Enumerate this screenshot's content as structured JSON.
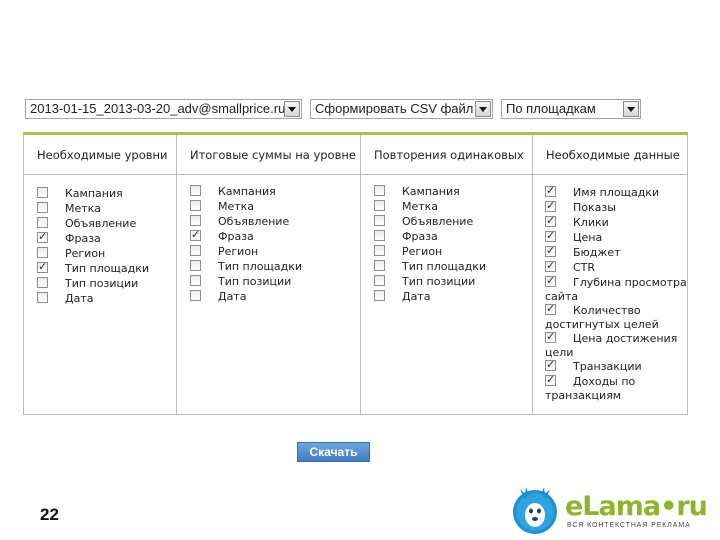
{
  "selects": {
    "file": "2013-01-15_2013-03-20_adv@smallprice.ru",
    "action": "Сформировать CSV файл",
    "grouping": "По площадкам"
  },
  "columns": [
    {
      "title": "Необходимые уровни",
      "items": [
        {
          "label": "Кампания",
          "checked": false
        },
        {
          "label": "Метка",
          "checked": false
        },
        {
          "label": "Объявление",
          "checked": false
        },
        {
          "label": "Фраза",
          "checked": true
        },
        {
          "label": "Регион",
          "checked": false
        },
        {
          "label": "Тип площадки",
          "checked": true
        },
        {
          "label": "Тип позиции",
          "checked": false
        },
        {
          "label": "Дата",
          "checked": false
        }
      ]
    },
    {
      "title": "Итоговые суммы на уровне",
      "items": [
        {
          "label": "Кампания",
          "checked": false
        },
        {
          "label": "Метка",
          "checked": false
        },
        {
          "label": "Объявление",
          "checked": false
        },
        {
          "label": "Фраза",
          "checked": true
        },
        {
          "label": "Регион",
          "checked": false
        },
        {
          "label": "Тип площадки",
          "checked": false
        },
        {
          "label": "Тип позиции",
          "checked": false
        },
        {
          "label": "Дата",
          "checked": false
        }
      ]
    },
    {
      "title": "Повторения одинаковых",
      "items": [
        {
          "label": "Кампания",
          "checked": false
        },
        {
          "label": "Метка",
          "checked": false
        },
        {
          "label": "Объявление",
          "checked": false
        },
        {
          "label": "Фраза",
          "checked": false
        },
        {
          "label": "Регион",
          "checked": false
        },
        {
          "label": "Тип площадки",
          "checked": false
        },
        {
          "label": "Тип позиции",
          "checked": false
        },
        {
          "label": "Дата",
          "checked": false
        }
      ]
    },
    {
      "title": "Необходимые данные",
      "items": [
        {
          "label": "Имя площадки",
          "checked": true
        },
        {
          "label": "Показы",
          "checked": true
        },
        {
          "label": "Клики",
          "checked": true
        },
        {
          "label": "Цена",
          "checked": true
        },
        {
          "label": "Бюджет",
          "checked": true
        },
        {
          "label": "CTR",
          "checked": true
        },
        {
          "label": "Глубина просмотра сайта",
          "checked": true
        },
        {
          "label": "Количество достигнутых целей",
          "checked": true
        },
        {
          "label": "Цена достижения цели",
          "checked": true
        },
        {
          "label": "Транзакции",
          "checked": true
        },
        {
          "label": "Доходы по транзакциям",
          "checked": true
        }
      ]
    }
  ],
  "download_label": "Скачать",
  "page_number": "22",
  "logo": {
    "brand": "eLama•ru",
    "tagline": "ВСЯ КОНТЕКСТНАЯ РЕКЛАМА"
  },
  "colors": {
    "accent_green": "#a6c143",
    "button_blue": "#4a88cc",
    "logo_green": "#8db52b",
    "logo_blue": "#1f8fd0"
  }
}
